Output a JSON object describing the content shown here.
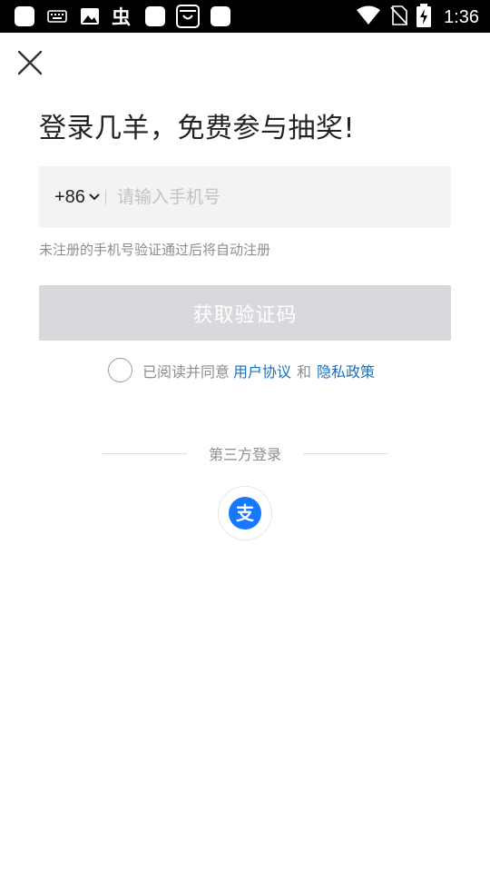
{
  "status_bar": {
    "time": "1:36",
    "left_icons": [
      "app-icon",
      "keyboard-icon",
      "image-icon",
      "wechat-icon",
      "app-icon",
      "shopping-icon",
      "app-icon"
    ],
    "right_icons": [
      "wifi-icon",
      "no-sim-icon",
      "battery-charging-icon"
    ]
  },
  "header": {
    "close_icon": "close-icon"
  },
  "main": {
    "title": "登录几羊，免费参与抽奖!",
    "phone": {
      "country_code": "+86",
      "placeholder": "请输入手机号",
      "value": ""
    },
    "hint": "未注册的手机号验证通过后将自动注册",
    "get_code_label": "获取验证码",
    "agreement": {
      "prefix": "已阅读并同意",
      "user_agreement": "用户协议",
      "and": "和",
      "privacy_policy": "隐私政策"
    },
    "third_party": {
      "label": "第三方登录",
      "alipay_icon": "alipay-icon",
      "alipay_glyph": "支"
    }
  },
  "colors": {
    "status_bar_bg": "#000000",
    "input_bg": "#f3f3f4",
    "button_disabled_bg": "#d8d8dd",
    "link": "#1a6fbf",
    "alipay_blue": "#1677ff"
  }
}
